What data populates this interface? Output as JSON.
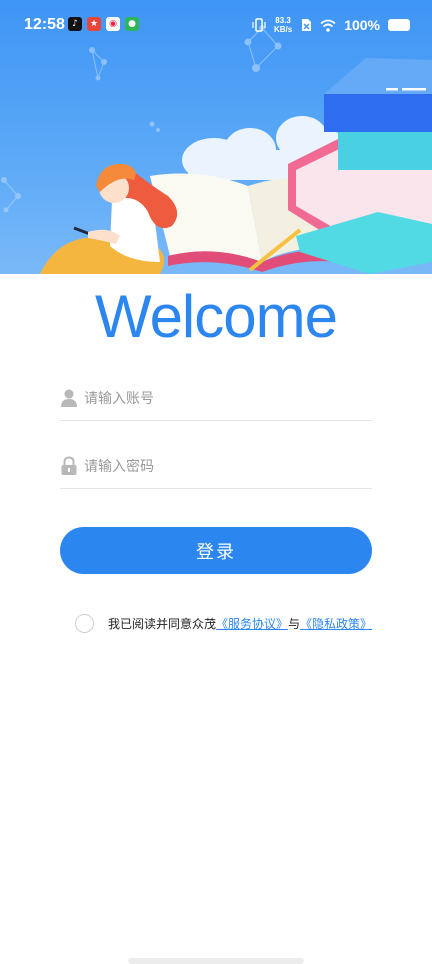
{
  "status_bar": {
    "time": "12:58",
    "net_speed_value": "83.3",
    "net_speed_unit": "KB/s",
    "battery": "100%"
  },
  "welcome_title": "Welcome",
  "form": {
    "account_placeholder": "请输入账号",
    "password_placeholder": "请输入密码",
    "login_label": "登录"
  },
  "agreement": {
    "prefix": "我已阅读并同意众茂",
    "service_link": "《服务协议》",
    "joiner": "与",
    "privacy_link": "《隐私政策》"
  },
  "colors": {
    "accent": "#2c86ef",
    "hero_bg": "#4a9cf6"
  }
}
